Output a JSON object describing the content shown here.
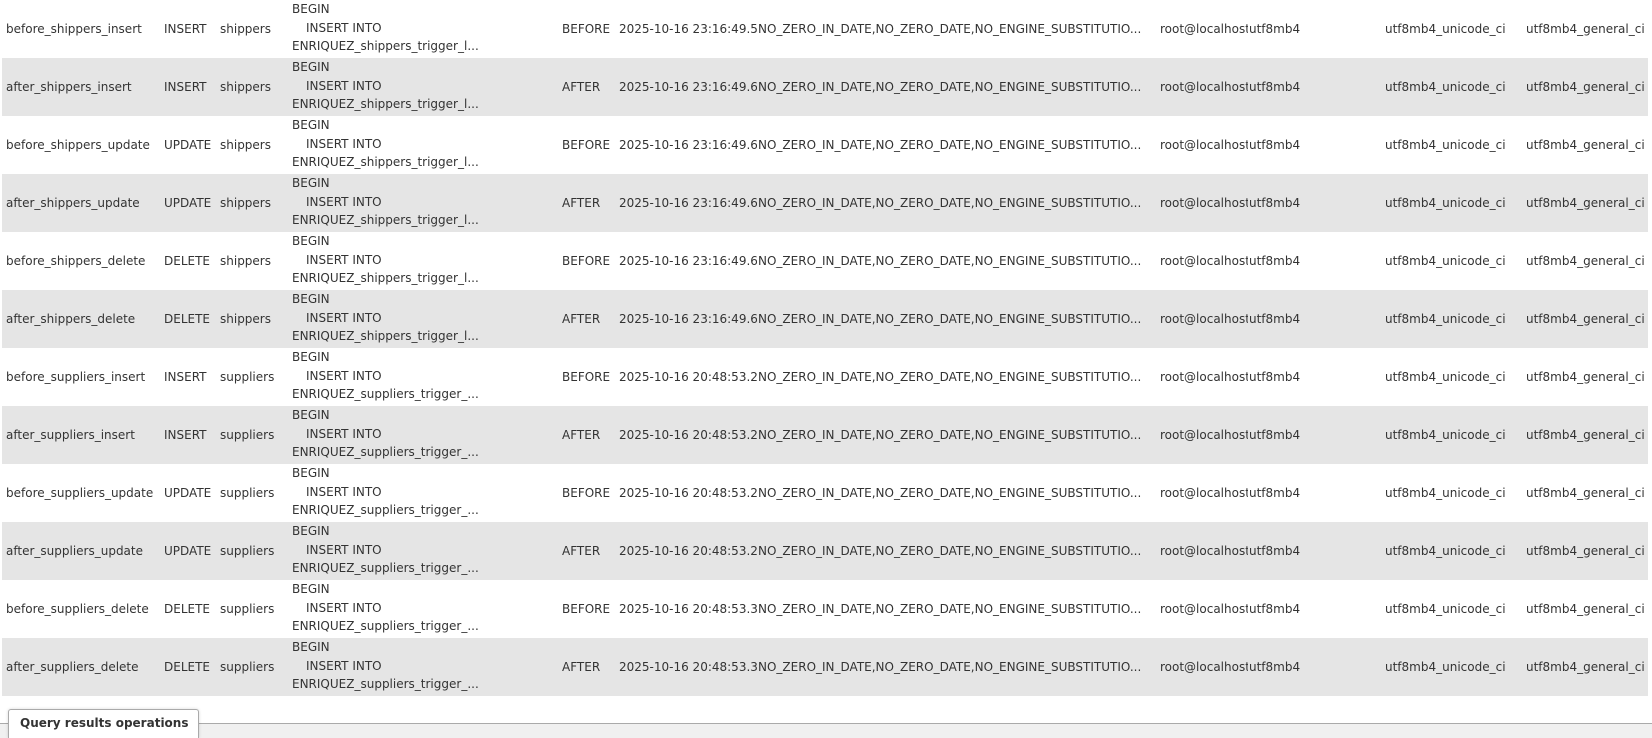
{
  "triggers": [
    {
      "name": "before_shippers_insert",
      "event": "INSERT",
      "table": "shippers",
      "stmt": [
        "BEGIN",
        "INSERT INTO",
        "ENRIQUEZ_shippers_trigger_l..."
      ],
      "timing": "BEFORE",
      "created": "2025-10-16 23:16:49.59",
      "sql_mode": "NO_ZERO_IN_DATE,NO_ZERO_DATE,NO_ENGINE_SUBSTITUTIO...",
      "definer": "root@localhost",
      "charset": "utf8mb4",
      "collation": "utf8mb4_unicode_ci",
      "db_collation": "utf8mb4_general_ci"
    },
    {
      "name": "after_shippers_insert",
      "event": "INSERT",
      "table": "shippers",
      "stmt": [
        "BEGIN",
        "INSERT INTO",
        "ENRIQUEZ_shippers_trigger_l..."
      ],
      "timing": "AFTER",
      "created": "2025-10-16 23:16:49.61",
      "sql_mode": "NO_ZERO_IN_DATE,NO_ZERO_DATE,NO_ENGINE_SUBSTITUTIO...",
      "definer": "root@localhost",
      "charset": "utf8mb4",
      "collation": "utf8mb4_unicode_ci",
      "db_collation": "utf8mb4_general_ci"
    },
    {
      "name": "before_shippers_update",
      "event": "UPDATE",
      "table": "shippers",
      "stmt": [
        "BEGIN",
        "INSERT INTO",
        "ENRIQUEZ_shippers_trigger_l..."
      ],
      "timing": "BEFORE",
      "created": "2025-10-16 23:16:49.63",
      "sql_mode": "NO_ZERO_IN_DATE,NO_ZERO_DATE,NO_ENGINE_SUBSTITUTIO...",
      "definer": "root@localhost",
      "charset": "utf8mb4",
      "collation": "utf8mb4_unicode_ci",
      "db_collation": "utf8mb4_general_ci"
    },
    {
      "name": "after_shippers_update",
      "event": "UPDATE",
      "table": "shippers",
      "stmt": [
        "BEGIN",
        "INSERT INTO",
        "ENRIQUEZ_shippers_trigger_l..."
      ],
      "timing": "AFTER",
      "created": "2025-10-16 23:16:49.65",
      "sql_mode": "NO_ZERO_IN_DATE,NO_ZERO_DATE,NO_ENGINE_SUBSTITUTIO...",
      "definer": "root@localhost",
      "charset": "utf8mb4",
      "collation": "utf8mb4_unicode_ci",
      "db_collation": "utf8mb4_general_ci"
    },
    {
      "name": "before_shippers_delete",
      "event": "DELETE",
      "table": "shippers",
      "stmt": [
        "BEGIN",
        "INSERT INTO",
        "ENRIQUEZ_shippers_trigger_l..."
      ],
      "timing": "BEFORE",
      "created": "2025-10-16 23:16:49.67",
      "sql_mode": "NO_ZERO_IN_DATE,NO_ZERO_DATE,NO_ENGINE_SUBSTITUTIO...",
      "definer": "root@localhost",
      "charset": "utf8mb4",
      "collation": "utf8mb4_unicode_ci",
      "db_collation": "utf8mb4_general_ci"
    },
    {
      "name": "after_shippers_delete",
      "event": "DELETE",
      "table": "shippers",
      "stmt": [
        "BEGIN",
        "INSERT INTO",
        "ENRIQUEZ_shippers_trigger_l..."
      ],
      "timing": "AFTER",
      "created": "2025-10-16 23:16:49.68",
      "sql_mode": "NO_ZERO_IN_DATE,NO_ZERO_DATE,NO_ENGINE_SUBSTITUTIO...",
      "definer": "root@localhost",
      "charset": "utf8mb4",
      "collation": "utf8mb4_unicode_ci",
      "db_collation": "utf8mb4_general_ci"
    },
    {
      "name": "before_suppliers_insert",
      "event": "INSERT",
      "table": "suppliers",
      "stmt": [
        "BEGIN",
        "INSERT INTO",
        "ENRIQUEZ_suppliers_trigger_..."
      ],
      "timing": "BEFORE",
      "created": "2025-10-16 20:48:53.21",
      "sql_mode": "NO_ZERO_IN_DATE,NO_ZERO_DATE,NO_ENGINE_SUBSTITUTIO...",
      "definer": "root@localhost",
      "charset": "utf8mb4",
      "collation": "utf8mb4_unicode_ci",
      "db_collation": "utf8mb4_general_ci"
    },
    {
      "name": "after_suppliers_insert",
      "event": "INSERT",
      "table": "suppliers",
      "stmt": [
        "BEGIN",
        "INSERT INTO",
        "ENRIQUEZ_suppliers_trigger_..."
      ],
      "timing": "AFTER",
      "created": "2025-10-16 20:48:53.25",
      "sql_mode": "NO_ZERO_IN_DATE,NO_ZERO_DATE,NO_ENGINE_SUBSTITUTIO...",
      "definer": "root@localhost",
      "charset": "utf8mb4",
      "collation": "utf8mb4_unicode_ci",
      "db_collation": "utf8mb4_general_ci"
    },
    {
      "name": "before_suppliers_update",
      "event": "UPDATE",
      "table": "suppliers",
      "stmt": [
        "BEGIN",
        "INSERT INTO",
        "ENRIQUEZ_suppliers_trigger_..."
      ],
      "timing": "BEFORE",
      "created": "2025-10-16 20:48:53.27",
      "sql_mode": "NO_ZERO_IN_DATE,NO_ZERO_DATE,NO_ENGINE_SUBSTITUTIO...",
      "definer": "root@localhost",
      "charset": "utf8mb4",
      "collation": "utf8mb4_unicode_ci",
      "db_collation": "utf8mb4_general_ci"
    },
    {
      "name": "after_suppliers_update",
      "event": "UPDATE",
      "table": "suppliers",
      "stmt": [
        "BEGIN",
        "INSERT INTO",
        "ENRIQUEZ_suppliers_trigger_..."
      ],
      "timing": "AFTER",
      "created": "2025-10-16 20:48:53.28",
      "sql_mode": "NO_ZERO_IN_DATE,NO_ZERO_DATE,NO_ENGINE_SUBSTITUTIO...",
      "definer": "root@localhost",
      "charset": "utf8mb4",
      "collation": "utf8mb4_unicode_ci",
      "db_collation": "utf8mb4_general_ci"
    },
    {
      "name": "before_suppliers_delete",
      "event": "DELETE",
      "table": "suppliers",
      "stmt": [
        "BEGIN",
        "INSERT INTO",
        "ENRIQUEZ_suppliers_trigger_..."
      ],
      "timing": "BEFORE",
      "created": "2025-10-16 20:48:53.30",
      "sql_mode": "NO_ZERO_IN_DATE,NO_ZERO_DATE,NO_ENGINE_SUBSTITUTIO...",
      "definer": "root@localhost",
      "charset": "utf8mb4",
      "collation": "utf8mb4_unicode_ci",
      "db_collation": "utf8mb4_general_ci"
    },
    {
      "name": "after_suppliers_delete",
      "event": "DELETE",
      "table": "suppliers",
      "stmt": [
        "BEGIN",
        "INSERT INTO",
        "ENRIQUEZ_suppliers_trigger_..."
      ],
      "timing": "AFTER",
      "created": "2025-10-16 20:48:53.32",
      "sql_mode": "NO_ZERO_IN_DATE,NO_ZERO_DATE,NO_ENGINE_SUBSTITUTIO...",
      "definer": "root@localhost",
      "charset": "utf8mb4",
      "collation": "utf8mb4_unicode_ci",
      "db_collation": "utf8mb4_general_ci"
    }
  ],
  "operations": {
    "tab_label": "Query results operations"
  },
  "colors": {
    "row_alt": "#e5e5e5",
    "text": "#333333"
  }
}
